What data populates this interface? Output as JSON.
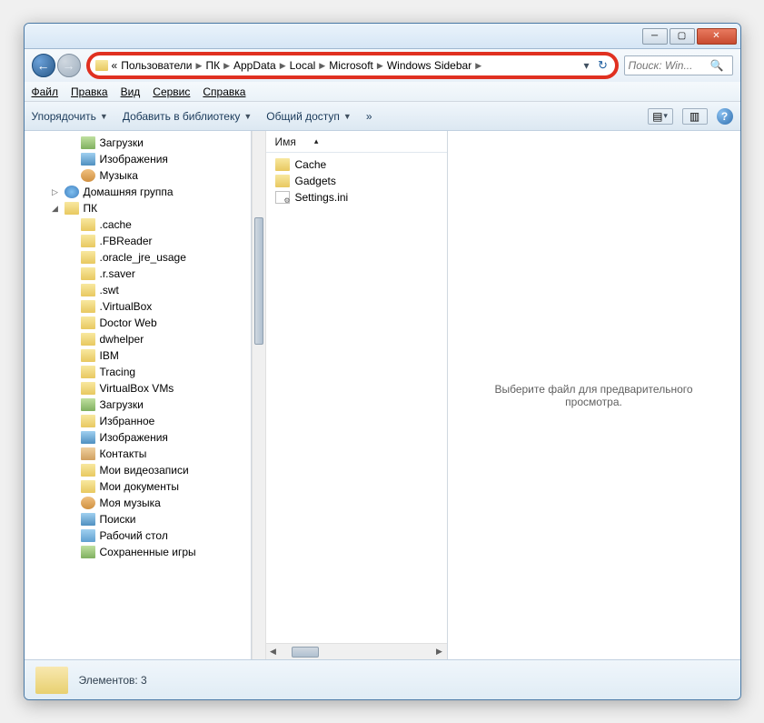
{
  "breadcrumb": {
    "prefix": "«",
    "items": [
      "Пользователи",
      "ПК",
      "AppData",
      "Local",
      "Microsoft",
      "Windows Sidebar"
    ]
  },
  "search": {
    "placeholder": "Поиск: Win..."
  },
  "menubar": {
    "file": "Файл",
    "edit": "Правка",
    "view": "Вид",
    "tools": "Сервис",
    "help": "Справка"
  },
  "toolbar": {
    "organize": "Упорядочить",
    "addlib": "Добавить в библиотеку",
    "share": "Общий доступ",
    "more": "»"
  },
  "tree": [
    {
      "indent": 1,
      "icon": "downloads",
      "label": "Загрузки",
      "expand": ""
    },
    {
      "indent": 1,
      "icon": "pictures",
      "label": "Изображения",
      "expand": ""
    },
    {
      "indent": 1,
      "icon": "music",
      "label": "Музыка",
      "expand": ""
    },
    {
      "indent": 0,
      "icon": "homegroup",
      "label": "Домашняя группа",
      "expand": "▷"
    },
    {
      "indent": 0,
      "icon": "user",
      "label": "ПК",
      "expand": "◢"
    },
    {
      "indent": 1,
      "icon": "folder",
      "label": ".cache",
      "expand": ""
    },
    {
      "indent": 1,
      "icon": "folder",
      "label": ".FBReader",
      "expand": ""
    },
    {
      "indent": 1,
      "icon": "folder",
      "label": ".oracle_jre_usage",
      "expand": ""
    },
    {
      "indent": 1,
      "icon": "folder",
      "label": ".r.saver",
      "expand": ""
    },
    {
      "indent": 1,
      "icon": "folder",
      "label": ".swt",
      "expand": ""
    },
    {
      "indent": 1,
      "icon": "folder",
      "label": ".VirtualBox",
      "expand": ""
    },
    {
      "indent": 1,
      "icon": "folder",
      "label": "Doctor Web",
      "expand": ""
    },
    {
      "indent": 1,
      "icon": "folder",
      "label": "dwhelper",
      "expand": ""
    },
    {
      "indent": 1,
      "icon": "folder",
      "label": "IBM",
      "expand": ""
    },
    {
      "indent": 1,
      "icon": "folder",
      "label": "Tracing",
      "expand": ""
    },
    {
      "indent": 1,
      "icon": "folder",
      "label": "VirtualBox VMs",
      "expand": ""
    },
    {
      "indent": 1,
      "icon": "downloads",
      "label": "Загрузки",
      "expand": ""
    },
    {
      "indent": 1,
      "icon": "folder",
      "label": "Избранное",
      "expand": ""
    },
    {
      "indent": 1,
      "icon": "pictures",
      "label": "Изображения",
      "expand": ""
    },
    {
      "indent": 1,
      "icon": "contacts",
      "label": "Контакты",
      "expand": ""
    },
    {
      "indent": 1,
      "icon": "folder",
      "label": "Мои видеозаписи",
      "expand": ""
    },
    {
      "indent": 1,
      "icon": "folder",
      "label": "Мои документы",
      "expand": ""
    },
    {
      "indent": 1,
      "icon": "music",
      "label": "Моя музыка",
      "expand": ""
    },
    {
      "indent": 1,
      "icon": "searches",
      "label": "Поиски",
      "expand": ""
    },
    {
      "indent": 1,
      "icon": "desktop",
      "label": "Рабочий стол",
      "expand": ""
    },
    {
      "indent": 1,
      "icon": "saved",
      "label": "Сохраненные игры",
      "expand": ""
    }
  ],
  "filelist": {
    "header": "Имя",
    "items": [
      {
        "icon": "folder",
        "name": "Cache"
      },
      {
        "icon": "folder",
        "name": "Gadgets"
      },
      {
        "icon": "ini",
        "name": "Settings.ini"
      }
    ]
  },
  "preview": {
    "text": "Выберите файл для предварительного просмотра."
  },
  "status": {
    "text": "Элементов: 3"
  }
}
